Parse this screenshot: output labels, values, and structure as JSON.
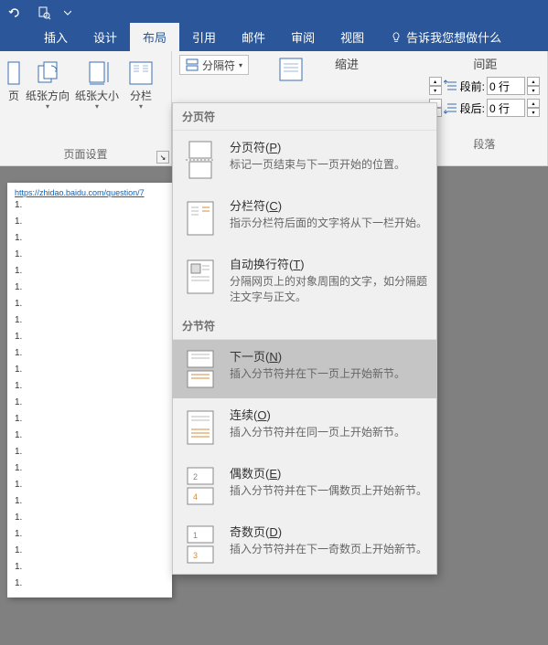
{
  "tabs": {
    "insert": "插入",
    "design": "设计",
    "layout": "布局",
    "references": "引用",
    "mailings": "邮件",
    "review": "审阅",
    "view": "视图",
    "tell_me": "告诉我您想做什么"
  },
  "ribbon": {
    "page_setup": {
      "orientation": "纸张方向",
      "size": "纸张大小",
      "columns": "分栏",
      "group_label": "页面设置",
      "breaks": "分隔符"
    },
    "indent": {
      "header": "缩进"
    },
    "spacing": {
      "header": "间距",
      "before_label": "段前:",
      "before_value": "0 行",
      "after_label": "段后:",
      "after_value": "0 行",
      "group_label": "段落"
    }
  },
  "dropdown": {
    "section1": "分页符",
    "page_break": {
      "title_a": "分页符(",
      "key": "P",
      "title_b": ")",
      "desc": "标记一页结束与下一页开始的位置。"
    },
    "column_break": {
      "title_a": "分栏符(",
      "key": "C",
      "title_b": ")",
      "desc": "指示分栏符后面的文字将从下一栏开始。"
    },
    "text_wrap": {
      "title_a": "自动换行符(",
      "key": "T",
      "title_b": ")",
      "desc": "分隔网页上的对象周围的文字，如分隔题注文字与正文。"
    },
    "section2": "分节符",
    "next_page": {
      "title_a": "下一页(",
      "key": "N",
      "title_b": ")",
      "desc": "插入分节符并在下一页上开始新节。"
    },
    "continuous": {
      "title_a": "连续(",
      "key": "O",
      "title_b": ")",
      "desc": "插入分节符并在同一页上开始新节。"
    },
    "even_page": {
      "title_a": "偶数页(",
      "key": "E",
      "title_b": ")",
      "desc": "插入分节符并在下一偶数页上开始新节。"
    },
    "odd_page": {
      "title_a": "奇数页(",
      "key": "D",
      "title_b": ")",
      "desc": "插入分节符并在下一奇数页上开始新节。"
    }
  },
  "doc": {
    "url": "https://zhidao.baidu.com/question/7",
    "lines": [
      "1.",
      "1.",
      "1.",
      "1.",
      "1.",
      "1.",
      "1.",
      "1.",
      "1.",
      "1.",
      "1.",
      "1.",
      "1.",
      "1.",
      "1.",
      "1.",
      "1.",
      "1.",
      "1.",
      "1.",
      "1.",
      "1.",
      "1.",
      "1."
    ]
  }
}
